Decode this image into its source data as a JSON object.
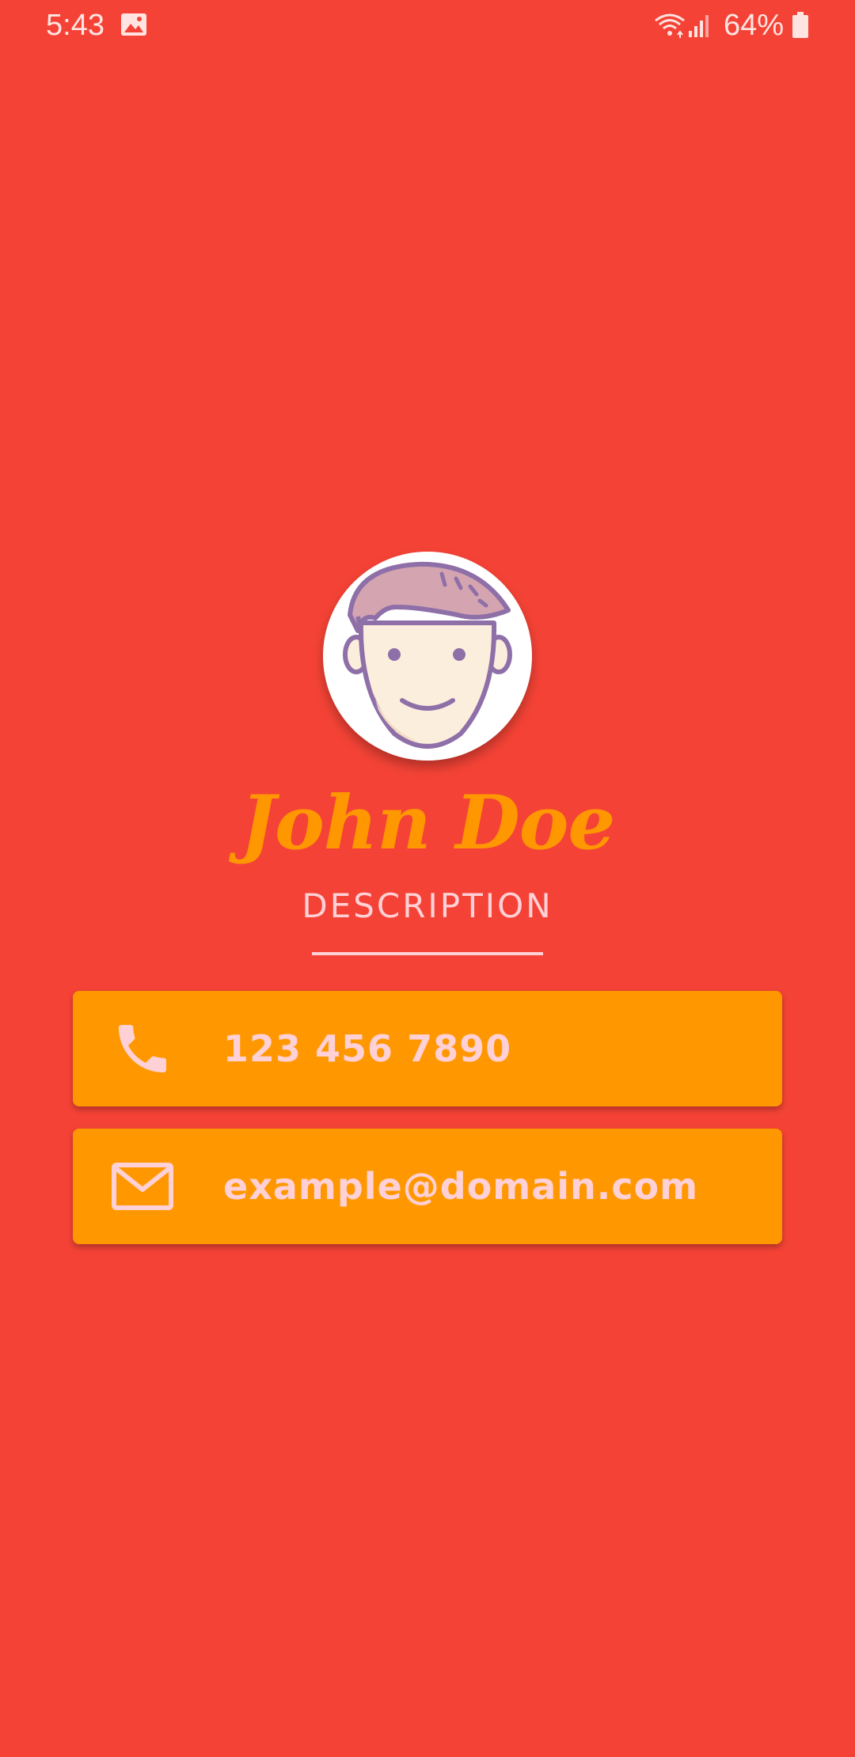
{
  "status_bar": {
    "time": "5:43",
    "battery_percent": "64%",
    "icons": [
      "gallery-icon",
      "wifi-icon",
      "signal-icon",
      "battery-icon"
    ]
  },
  "profile": {
    "avatar_icon": "man-face-avatar",
    "name": "John Doe",
    "description": "DESCRIPTION"
  },
  "contacts": {
    "phone": {
      "icon": "phone-icon",
      "value": "123 456 7890"
    },
    "email": {
      "icon": "mail-icon",
      "value": "example@domain.com"
    }
  },
  "colors": {
    "background": "#f44336",
    "accent": "#ff9800",
    "text_light": "#ffd0d6",
    "avatar_outline": "#8e6fa8"
  }
}
